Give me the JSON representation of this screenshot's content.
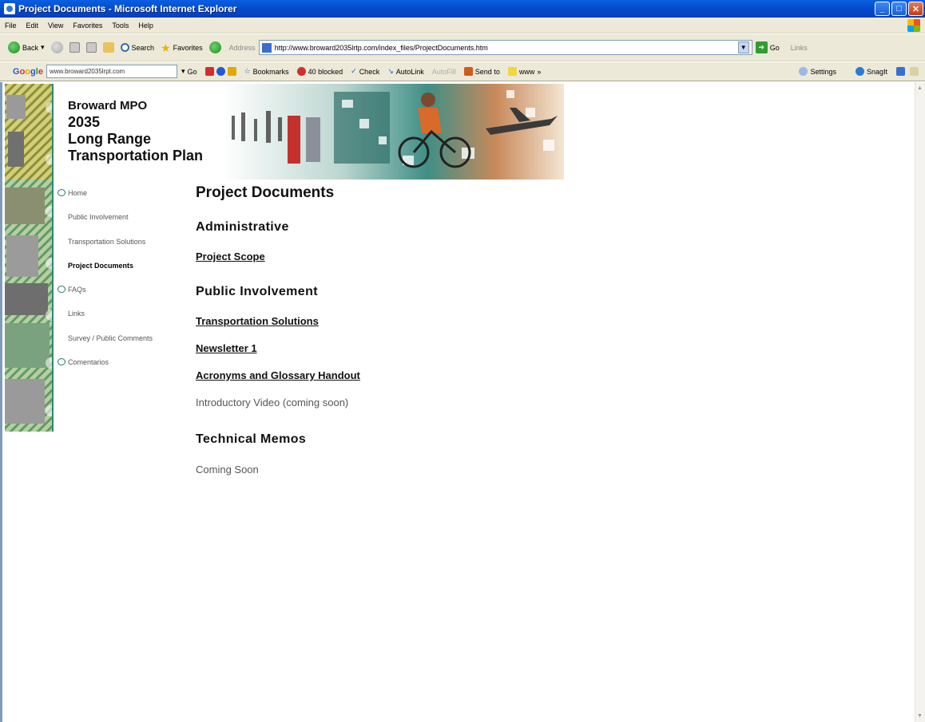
{
  "window": {
    "title": "Project Documents - Microsoft Internet Explorer",
    "min": "_",
    "max": "□",
    "close": "✕"
  },
  "menubar": {
    "items": [
      "File",
      "Edit",
      "View",
      "Favorites",
      "Tools",
      "Help"
    ]
  },
  "toolbar": {
    "back": "Back",
    "search": "Search",
    "favorites": "Favorites",
    "address_label": "Address",
    "address_value": "http://www.broward2035lrtp.com/index_files/ProjectDocuments.htm",
    "go": "Go",
    "links": "Links"
  },
  "google_toolbar": {
    "search_value": "www.broward2035lrpt.com",
    "go_btn": "Go",
    "bookmarks": "Bookmarks",
    "blocked": "40 blocked",
    "check": "Check",
    "autolink": "AutoLink",
    "autofill": "AutoFill",
    "sendto": "Send to",
    "extra": "www",
    "settings": "Settings",
    "snagit": "SnagIt"
  },
  "site": {
    "title_lines": [
      "Broward MPO",
      "2035",
      "Long Range",
      "Transportation Plan"
    ]
  },
  "nav": {
    "items": [
      {
        "label": "Home",
        "active": false
      },
      {
        "label": "Public Involvement",
        "active": false
      },
      {
        "label": "Transportation Solutions",
        "active": false
      },
      {
        "label": "Project Documents",
        "active": true
      },
      {
        "label": "FAQs",
        "active": false
      },
      {
        "label": "Links",
        "active": false
      },
      {
        "label": "Survey / Public Comments",
        "active": false
      },
      {
        "label": "Comentarios",
        "active": false
      }
    ]
  },
  "main": {
    "page_title": "Project Documents",
    "sections": [
      {
        "heading": "Administrative",
        "items": [
          {
            "label": "Project Scope",
            "link": true
          }
        ]
      },
      {
        "heading": "Public Involvement",
        "items": [
          {
            "label": "Transportation Solutions",
            "link": true
          },
          {
            "label": "Newsletter 1",
            "link": true
          },
          {
            "label": "Acronyms and Glossary Handout",
            "link": true
          },
          {
            "label": "Introductory Video (coming soon)",
            "link": false
          }
        ]
      },
      {
        "heading": "Technical Memos",
        "items": [
          {
            "label": "Coming Soon",
            "link": false
          }
        ]
      }
    ]
  }
}
